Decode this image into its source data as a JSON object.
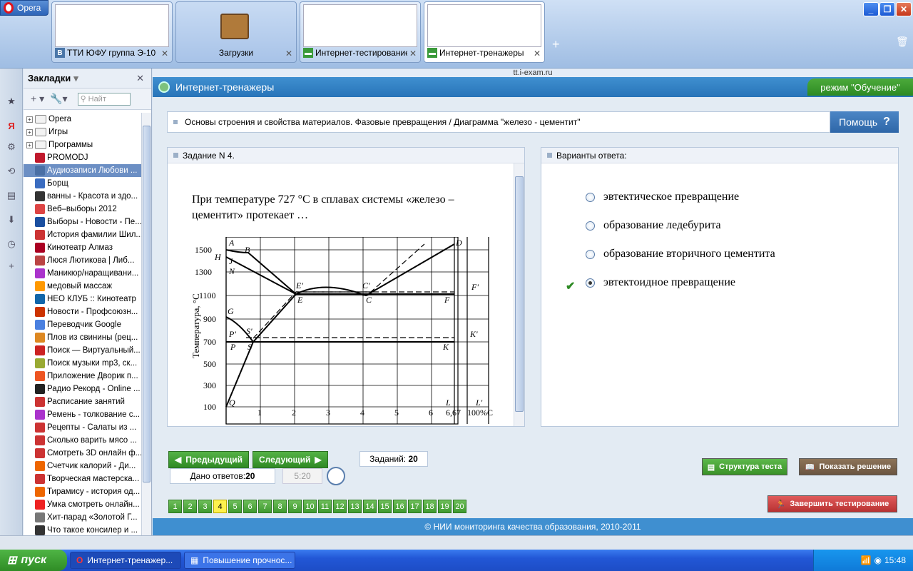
{
  "browser": {
    "menu_label": "Opera",
    "tabs": [
      {
        "title": "ТТИ ЮФУ группа Э-10"
      },
      {
        "title": "Загрузки"
      },
      {
        "title": "Интернет-тестирование"
      },
      {
        "title": "Интернет-тренажеры"
      }
    ],
    "url": "tt.i-exam.ru"
  },
  "bookmarks": {
    "title": "Закладки",
    "search_placeholder": "Найт",
    "items": [
      {
        "label": "Opera",
        "type": "folder"
      },
      {
        "label": "Игры",
        "type": "folder"
      },
      {
        "label": "Программы",
        "type": "folder"
      },
      {
        "label": "PROMODJ",
        "color": "#c0182c"
      },
      {
        "label": "Аудиозаписи Любови ...",
        "color": "#4a6fa5",
        "selected": true
      },
      {
        "label": "Борщ",
        "color": "#3a6cc0"
      },
      {
        "label": "ванны - Красота и здо...",
        "color": "#333"
      },
      {
        "label": "Веб–выборы 2012",
        "color": "#d44"
      },
      {
        "label": "Выборы - Новости - Пе...",
        "color": "#1a4fa0"
      },
      {
        "label": "История фамилии Шил...",
        "color": "#c33"
      },
      {
        "label": "Кинотеатр Алмаз",
        "color": "#a02"
      },
      {
        "label": "Люся Лютикова | Либ...",
        "color": "#b44"
      },
      {
        "label": "Маникюр/наращивани...",
        "color": "#a3c"
      },
      {
        "label": "медовый массаж",
        "color": "#f90"
      },
      {
        "label": "НЕО КЛУБ :: Кинотеатр",
        "color": "#16a"
      },
      {
        "label": "Новости - Профсоюзн...",
        "color": "#c30"
      },
      {
        "label": "Переводчик Google",
        "color": "#4a80e0"
      },
      {
        "label": "Плов из свинины (рец...",
        "color": "#d82"
      },
      {
        "label": "Поиск — Виртуальный...",
        "color": "#c22"
      },
      {
        "label": "Поиск музыки mp3, ск...",
        "color": "#9a3"
      },
      {
        "label": "Приложение Дворик п...",
        "color": "#e52"
      },
      {
        "label": "Радио Рекорд - Online ...",
        "color": "#222"
      },
      {
        "label": "Расписание занятий",
        "color": "#c33"
      },
      {
        "label": "Ремень - толкование с...",
        "color": "#a3c"
      },
      {
        "label": "Рецепты - Салаты из ...",
        "color": "#c33"
      },
      {
        "label": "Сколько варить мясо ...",
        "color": "#c33"
      },
      {
        "label": "Смотреть 3D онлайн ф...",
        "color": "#c33"
      },
      {
        "label": "Счетчик калорий - Ди...",
        "color": "#e60"
      },
      {
        "label": "Творческая мастерска...",
        "color": "#c33"
      },
      {
        "label": "Тирамису - история од...",
        "color": "#e60"
      },
      {
        "label": "Умка смотреть онлайн...",
        "color": "#e22"
      },
      {
        "label": "Хит-парад «Золотой Г...",
        "color": "#777"
      },
      {
        "label": "Что такое консилер и ...",
        "color": "#333"
      }
    ]
  },
  "app": {
    "title": "Интернет-тренажеры",
    "mode": "режим \"Обучение\"",
    "topic": "Основы строения и свойства материалов. Фазовые превращения / Диаграмма \"железо - цементит\"",
    "help_label": "Помощь",
    "help_icon": "?",
    "task_header": "Задание N 4.",
    "question": "При температуре 727 °С в сплавах системы «железо – цементит» протекает …",
    "answers_header": "Варианты ответа:",
    "answers": [
      {
        "text": "эвтектическое превращение",
        "selected": false
      },
      {
        "text": "образование ледебурита",
        "selected": false
      },
      {
        "text": "образование вторичного цементита",
        "selected": false
      },
      {
        "text": "эвтектоидное превращение",
        "selected": true
      }
    ],
    "prev_label": "Предыдущий",
    "next_label": "Следующий",
    "tasks_label": "Заданий:",
    "tasks_count": "20",
    "answered_label": "Дано ответов:",
    "answered_count": "20",
    "timer": "5:20",
    "structure_label": "Структура теста",
    "solution_label": "Показать решение",
    "finish_label": "Завершить тестирование",
    "pages": [
      "1",
      "2",
      "3",
      "4",
      "5",
      "6",
      "7",
      "8",
      "9",
      "10",
      "11",
      "12",
      "13",
      "14",
      "15",
      "16",
      "17",
      "18",
      "19",
      "20"
    ],
    "current_page": "4",
    "footer": "© НИИ мониторинга качества образования, 2010-2011"
  },
  "diagram": {
    "ylabel": "Температура, °С",
    "y_ticks": [
      "1500",
      "1300",
      "1100",
      "900",
      "700",
      "500",
      "300",
      "100"
    ],
    "x_ticks": [
      "1",
      "2",
      "3",
      "4",
      "5",
      "6",
      "6,67",
      "100%С"
    ],
    "points": [
      "A",
      "B",
      "H",
      "J",
      "N",
      "E'",
      "E",
      "C'",
      "C",
      "F'",
      "F",
      "D",
      "G",
      "P'",
      "S'",
      "P",
      "S",
      "K'",
      "K",
      "Q",
      "L",
      "L'"
    ]
  },
  "taskbar": {
    "start": "пуск",
    "items": [
      {
        "label": "Интернет-тренажер..."
      },
      {
        "label": "Повышение прочнос..."
      }
    ],
    "clock": "15:48"
  }
}
